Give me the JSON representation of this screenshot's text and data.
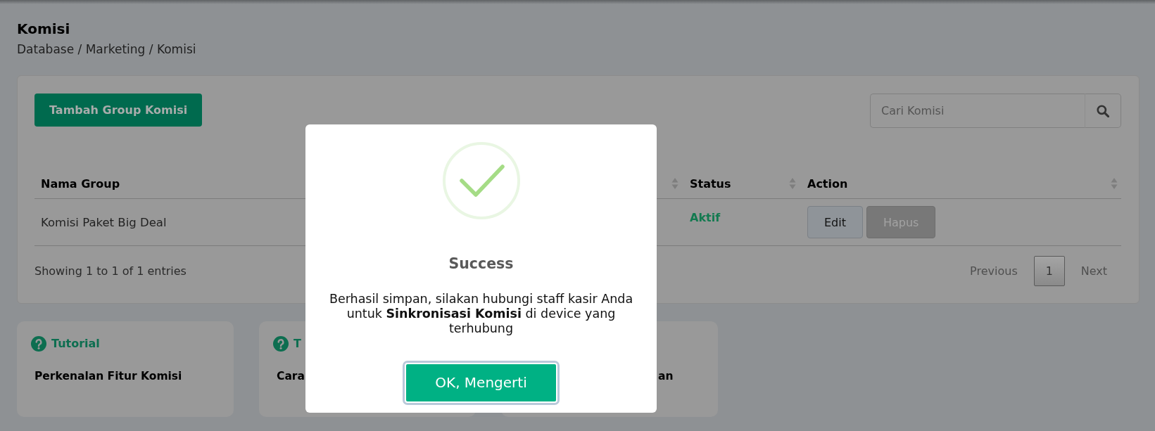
{
  "header": {
    "title": "Komisi",
    "breadcrumb": "Database / Marketing / Komisi"
  },
  "toolbar": {
    "add_button": "Tambah Group Komisi",
    "search": {
      "placeholder": "Cari Komisi"
    }
  },
  "table": {
    "columns": [
      {
        "label": "Nama Group",
        "sortable": false
      },
      {
        "sortable": true
      },
      {
        "label": "Status",
        "sortable": true
      },
      {
        "label": "Action",
        "sortable": true
      }
    ],
    "rows": [
      {
        "nama_group": "Komisi Paket Big Deal",
        "status": "Aktif",
        "actions": [
          {
            "label": "Edit",
            "disabled": false
          },
          {
            "label": "Hapus",
            "disabled": true
          }
        ]
      }
    ]
  },
  "table_info": "Showing 1 to 1 of 1 entries",
  "pagination": [
    {
      "label": "Previous",
      "selected": false
    },
    {
      "label": "1",
      "selected": true
    },
    {
      "label": "Next",
      "selected": false
    }
  ],
  "tutorial_cards": [
    {
      "tag": "Tutorial",
      "title": "Perkenalan Fitur Komisi"
    },
    {
      "tag": "T",
      "title": "Cara"
    },
    {
      "title": "an"
    }
  ],
  "dialog": {
    "title": "Success",
    "message": "Berhasil simpan, silakan hubungi staff kasir Anda untuk **Sinkronisasi Komisi** di device yang terhubung",
    "button": "OK, Mengerti"
  }
}
